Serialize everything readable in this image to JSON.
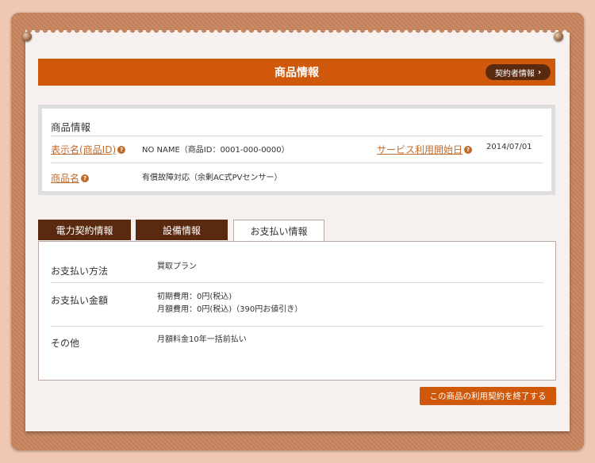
{
  "header": {
    "title": "商品情報",
    "contract_button": "契約者情報"
  },
  "info": {
    "section_title": "商品情報",
    "display_name_label": "表示名(商品ID)",
    "display_name_value": "NO NAME（商品ID：0001-000-0000）",
    "service_start_label": "サービス利用開始日",
    "service_start_value": "2014/07/01",
    "product_name_label": "商品名",
    "product_name_value": "有償故障対応（余剰AC式PVセンサー）"
  },
  "tabs": [
    {
      "label": "電力契約情報"
    },
    {
      "label": "設備情報"
    },
    {
      "label": "お支払い情報"
    }
  ],
  "payment": {
    "method_label": "お支払い方法",
    "method_value": "買取プラン",
    "amount_label": "お支払い金額",
    "amount_value_1": "初期費用：0円(税込)",
    "amount_value_2": "月額費用：0円(税込)（390円お値引き）",
    "other_label": "その他",
    "other_value": "月額料金10年一括前払い"
  },
  "end_button": "この商品の利用契約を終了する",
  "colors": {
    "accent": "#d0580a",
    "dark_brown": "#5a2a10",
    "link": "#c06a2a"
  }
}
